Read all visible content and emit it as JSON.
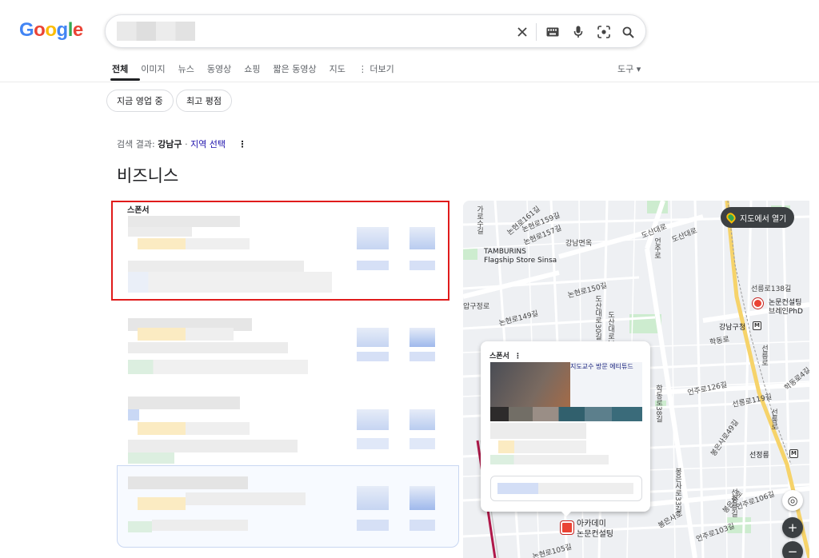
{
  "logo": {
    "text": [
      "G",
      "o",
      "o",
      "g",
      "l",
      "e"
    ]
  },
  "search": {
    "query": ""
  },
  "tabs": [
    {
      "label": "전체",
      "active": true
    },
    {
      "label": "이미지"
    },
    {
      "label": "뉴스"
    },
    {
      "label": "동영상"
    },
    {
      "label": "쇼핑"
    },
    {
      "label": "짧은 동영상"
    },
    {
      "label": "지도"
    },
    {
      "label": "⋮ 더보기"
    }
  ],
  "tools_label": "도구 ▾",
  "chips": [
    "지금 영업 중",
    "최고 평점"
  ],
  "results_meta": {
    "prefix": "검색 결과:",
    "location": "강남구",
    "separator": "·",
    "link": "지역 선택",
    "more": "⋮"
  },
  "section_title": "비즈니스",
  "sponsor_label": "스폰서",
  "map": {
    "open_button": "지도에서 열기",
    "labels": [
      "도산대로",
      "TAMBURINS",
      "Flagship Store Sinsa",
      "강남면옥",
      "논현로159길",
      "논현로157길",
      "논현로161길",
      "논현로150길",
      "도산대로30길",
      "언주로",
      "선릉로138길",
      "논문컨설팅",
      "브레인PhD",
      "강남구청",
      "학동로",
      "선릉로",
      "언주로126길",
      "선릉로119길",
      "봉은사로",
      "선정릉",
      "언주로106길",
      "언주로103길",
      "봉은사로",
      "논현로105길",
      "논현로149길",
      "도산대로",
      "가로수길",
      "압구정로",
      "학동로38길",
      "봉은사로33길",
      "선릉로",
      "선정릉길",
      "도산대로38길",
      "학동로4길",
      "봉은사로49길"
    ],
    "metro_glyph": "M",
    "zoom_in": "+",
    "zoom_out": "−",
    "locate_glyph": "◎",
    "card": {
      "label": "스폰서",
      "more": "⋮",
      "ad_text": "지도교수 방문 에티튜드"
    },
    "business_label_line1": "아카데미",
    "business_label_line2": "논문컨설팅"
  },
  "icons": [
    "clear-icon",
    "keyboard-icon",
    "mic-icon",
    "lens-icon",
    "search-icon"
  ],
  "colors": {
    "accent": "#1a0dab",
    "highlight_border": "#e01b1b",
    "pin": "#ea4335"
  }
}
